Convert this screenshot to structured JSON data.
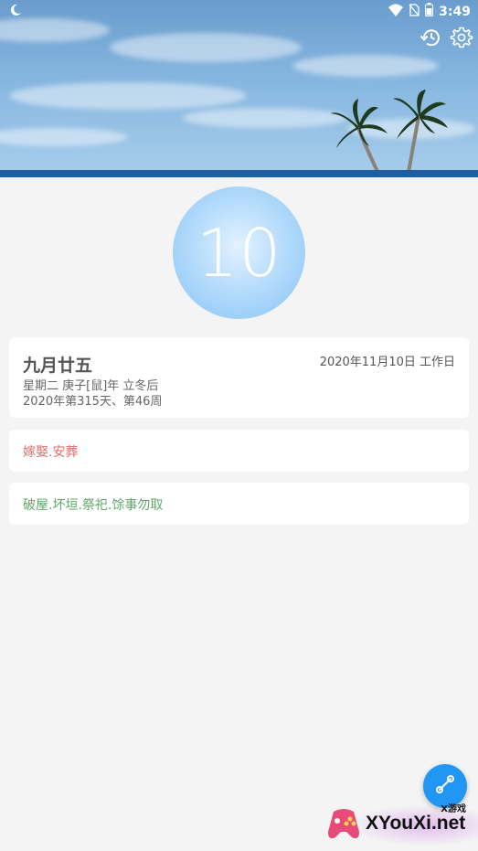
{
  "status_bar": {
    "time": "3:49"
  },
  "header": {
    "history_icon": "history-icon",
    "settings_icon": "gear-icon"
  },
  "day": {
    "number": "10"
  },
  "info": {
    "lunar_date": "九月廿五",
    "solar_date": "2020年11月10日 工作日",
    "line2": "星期二 庚子[鼠]年 立冬后",
    "line3": "2020年第315天、第46周"
  },
  "yi": {
    "text": "嫁娶.安葬"
  },
  "ji": {
    "text": "破屋.坏垣.祭祀.馀事勿取"
  },
  "fab": {
    "icon": "link-icon"
  },
  "watermark": {
    "small": "X游戏",
    "big": "XYouXi.net"
  },
  "colors": {
    "accent": "#2196f3",
    "yi": "#e06c6c",
    "ji": "#5fa86a"
  }
}
